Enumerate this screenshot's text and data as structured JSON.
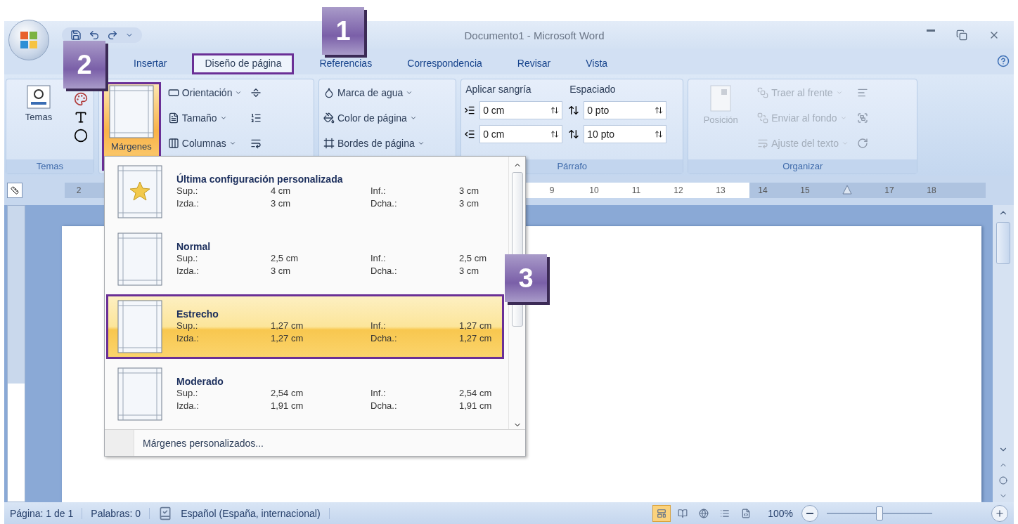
{
  "window": {
    "title": "Documento1 - Microsoft Word"
  },
  "tabs": [
    {
      "label": "Insertar",
      "selected": false
    },
    {
      "label": "Diseño de página",
      "selected": true
    },
    {
      "label": "Referencias",
      "selected": false
    },
    {
      "label": "Correspondencia",
      "selected": false
    },
    {
      "label": "Revisar",
      "selected": false
    },
    {
      "label": "Vista",
      "selected": false
    }
  ],
  "ribbon": {
    "themes": {
      "button": "Temas",
      "group_label": "Temas"
    },
    "page_setup": {
      "margins_button": {
        "label": "Márgenes",
        "pressed": true
      },
      "commands": [
        {
          "label": "Orientación"
        },
        {
          "label": "Tamaño"
        },
        {
          "label": "Columnas"
        }
      ]
    },
    "page_background": {
      "commands": [
        {
          "label": "Marca de agua"
        },
        {
          "label": "Color de página"
        },
        {
          "label": "Bordes de página"
        }
      ]
    },
    "paragraph": {
      "indent_heading": "Aplicar sangría",
      "indent_values": [
        "0 cm",
        "0 cm"
      ],
      "spacing_heading": "Espaciado",
      "spacing_values": [
        "0 pto",
        "10 pto"
      ],
      "group_label": "Párrafo"
    },
    "arrange": {
      "position_button": {
        "label": "Posición",
        "disabled": true
      },
      "commands": [
        {
          "label": "Traer al frente",
          "disabled": true
        },
        {
          "label": "Enviar al fondo",
          "disabled": true
        },
        {
          "label": "Ajuste del texto",
          "disabled": true
        }
      ],
      "group_label": "Organizar"
    }
  },
  "ruler": {
    "left_label": "2",
    "right_labels": [
      "9",
      "10",
      "11",
      "12",
      "13",
      "14",
      "15"
    ],
    "far_labels": [
      "17",
      "18"
    ]
  },
  "margins_menu": {
    "items": [
      {
        "name": "Última configuración personalizada",
        "starred": true,
        "selected": false,
        "values": [
          "Sup.:",
          "4 cm",
          "Inf.:",
          "3 cm",
          "Izda.:",
          "3 cm",
          "Dcha.:",
          "3 cm"
        ]
      },
      {
        "name": "Normal",
        "starred": false,
        "selected": false,
        "values": [
          "Sup.:",
          "2,5 cm",
          "Inf.:",
          "2,5 cm",
          "Izda.:",
          "3 cm",
          "Dcha.:",
          "3 cm"
        ]
      },
      {
        "name": "Estrecho",
        "starred": false,
        "selected": true,
        "values": [
          "Sup.:",
          "1,27 cm",
          "Inf.:",
          "1,27 cm",
          "Izda.:",
          "1,27 cm",
          "Dcha.:",
          "1,27 cm"
        ]
      },
      {
        "name": "Moderado",
        "starred": false,
        "selected": false,
        "values": [
          "Sup.:",
          "2,54 cm",
          "Inf.:",
          "2,54 cm",
          "Izda.:",
          "1,91 cm",
          "Dcha.:",
          "1,91 cm"
        ]
      }
    ],
    "footer": "Márgenes personalizados..."
  },
  "status_bar": {
    "page": "Página: 1 de 1",
    "words": "Palabras: 0",
    "language": "Español (España, internacional)",
    "views": [
      {
        "selected": true
      },
      {
        "selected": false
      },
      {
        "selected": false
      },
      {
        "selected": false
      },
      {
        "selected": false
      }
    ],
    "zoom": "100%",
    "zoom_slider": {
      "level": 0.5
    }
  },
  "callouts": [
    "1",
    "2",
    "3"
  ]
}
